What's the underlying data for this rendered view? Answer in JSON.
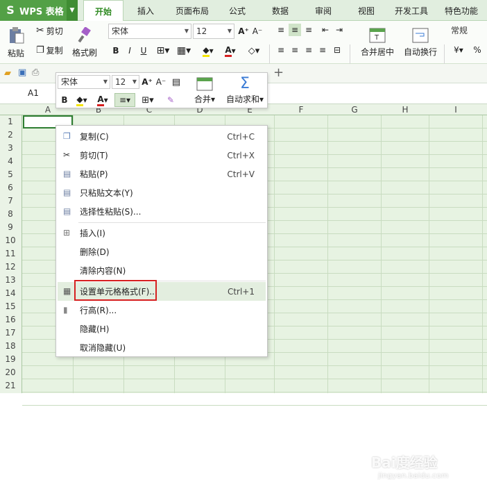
{
  "app": {
    "name": "WPS 表格"
  },
  "tabs": [
    "开始",
    "插入",
    "页面布局",
    "公式",
    "数据",
    "审阅",
    "视图",
    "开发工具",
    "特色功能"
  ],
  "ribbon": {
    "paste": "粘贴",
    "cut": "剪切",
    "copy": "复制",
    "format_painter": "格式刷",
    "font_name": "宋体",
    "font_size": "12",
    "merge_center": "合并居中",
    "wrap_text": "自动换行",
    "number_format": "常规",
    "percent": "%"
  },
  "formula_bar": {
    "cell_ref": "A1"
  },
  "mini_toolbar": {
    "font_name": "宋体",
    "font_size": "12",
    "merge": "合并",
    "autosum": "自动求和"
  },
  "columns": [
    "A",
    "B",
    "C",
    "D",
    "E",
    "F",
    "G",
    "H",
    "I"
  ],
  "rows": [
    "1",
    "2",
    "3",
    "4",
    "5",
    "6",
    "7",
    "8",
    "9",
    "10",
    "11",
    "12",
    "13",
    "14",
    "15",
    "16",
    "17",
    "18",
    "19",
    "20",
    "21"
  ],
  "context_menu": {
    "items": [
      {
        "label": "复制(C)",
        "shortcut": "Ctrl+C"
      },
      {
        "label": "剪切(T)",
        "shortcut": "Ctrl+X"
      },
      {
        "label": "粘贴(P)",
        "shortcut": "Ctrl+V"
      },
      {
        "label": "只粘贴文本(Y)",
        "shortcut": ""
      },
      {
        "label": "选择性粘贴(S)...",
        "shortcut": ""
      },
      {
        "label": "插入(I)",
        "shortcut": ""
      },
      {
        "label": "删除(D)",
        "shortcut": ""
      },
      {
        "label": "清除内容(N)",
        "shortcut": ""
      },
      {
        "label": "设置单元格格式(F)...",
        "shortcut": "Ctrl+1"
      },
      {
        "label": "行高(R)...",
        "shortcut": ""
      },
      {
        "label": "隐藏(H)",
        "shortcut": ""
      },
      {
        "label": "取消隐藏(U)",
        "shortcut": ""
      }
    ]
  },
  "watermark": {
    "text": "Bai度经验",
    "url": "jingyan.baidu.com"
  },
  "colors": {
    "accent": "#53a046",
    "highlight": "#d62020",
    "grid_bg": "#e7f3e2"
  }
}
